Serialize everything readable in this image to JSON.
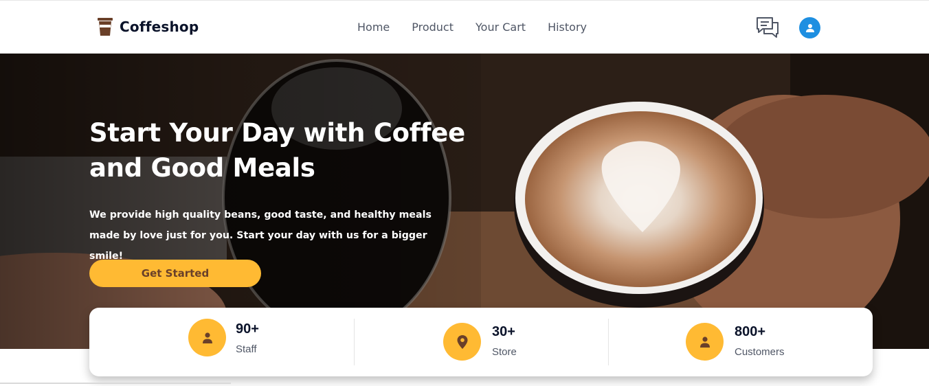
{
  "brand": {
    "name": "Coffeshop",
    "icon": "coffee-cup-icon"
  },
  "nav": {
    "items": [
      {
        "label": "Home"
      },
      {
        "label": "Product"
      },
      {
        "label": "Your Cart"
      },
      {
        "label": "History"
      }
    ]
  },
  "header_icons": {
    "chat": "chat-icon",
    "profile": "user-icon"
  },
  "hero": {
    "title": "Start Your Day with Coffee and Good Meals",
    "description": "We provide high quality beans, good taste, and healthy meals made by love just for you. Start your day with us for a bigger smile!",
    "cta_label": "Get Started"
  },
  "stats": [
    {
      "value": "90+",
      "label": "Staff",
      "icon": "person-icon"
    },
    {
      "value": "30+",
      "label": "Store",
      "icon": "location-pin-icon"
    },
    {
      "value": "800+",
      "label": "Customers",
      "icon": "person-icon"
    }
  ],
  "colors": {
    "accent": "#ffba33",
    "cta_text": "#6a4029",
    "nav_text": "#4f5665",
    "dark_text": "#0b132a",
    "profile_blue": "#1e8fe1"
  }
}
